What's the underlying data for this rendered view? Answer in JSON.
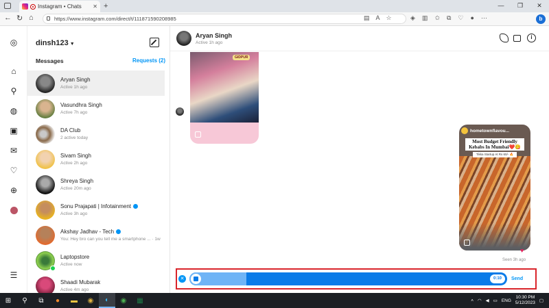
{
  "browser": {
    "tab_title": "Instagram • Chats",
    "tab_close": "✕",
    "new_tab": "+",
    "url": "https://www.instagram.com/direct/t/111871590208985",
    "window_controls": [
      "—",
      "❐",
      "✕"
    ],
    "profile_badge": "b"
  },
  "rail": {
    "icons": [
      "instagram-icon",
      "home-icon",
      "search-icon",
      "explore-icon",
      "reels-icon",
      "messenger-icon",
      "heart-icon",
      "create-icon",
      "profile-icon",
      "menu-icon"
    ]
  },
  "list": {
    "account": "dinsh123",
    "messages_label": "Messages",
    "requests_label": "Requests (2)",
    "conversations": [
      {
        "name": "Aryan Singh",
        "status": "Active 1h ago"
      },
      {
        "name": "Vasundhra Singh",
        "status": "Active 7h ago"
      },
      {
        "name": "DA Club",
        "status": "2 active today"
      },
      {
        "name": "Sivam Singh",
        "status": "Active 2h ago"
      },
      {
        "name": "Shreya Singh",
        "status": "Active 20m ago"
      },
      {
        "name": "Sonu Prajapati | Infotainment",
        "status": "Active 3h ago"
      },
      {
        "name": "Akshay Jadhav - Tech",
        "status": "You: Hey bro can you tell me a smartphone ... · 1w"
      },
      {
        "name": "Laptopstore",
        "status": "Active now"
      },
      {
        "name": "Shaadi Mubarak",
        "status": "Active 4m ago"
      }
    ]
  },
  "chat": {
    "name": "Aryan Singh",
    "status": "Active 1h ago",
    "reel1_tag": "GIDPUR",
    "reel2": {
      "account": "hometownflavou...",
      "title": "Most Budget Friendly Kebabs In Mumbai❤️😋",
      "subtitle": "Tikka Startup At Rs 60/- 🔥"
    },
    "seen": "Seen 3h ago",
    "heart": "♥"
  },
  "recorder": {
    "cancel": "✕",
    "timer": "0:10",
    "progress": 0.18,
    "send_label": "Send"
  },
  "taskbar": {
    "lang": "ENG",
    "time": "10:30 PM",
    "date": "5/12/2023"
  }
}
